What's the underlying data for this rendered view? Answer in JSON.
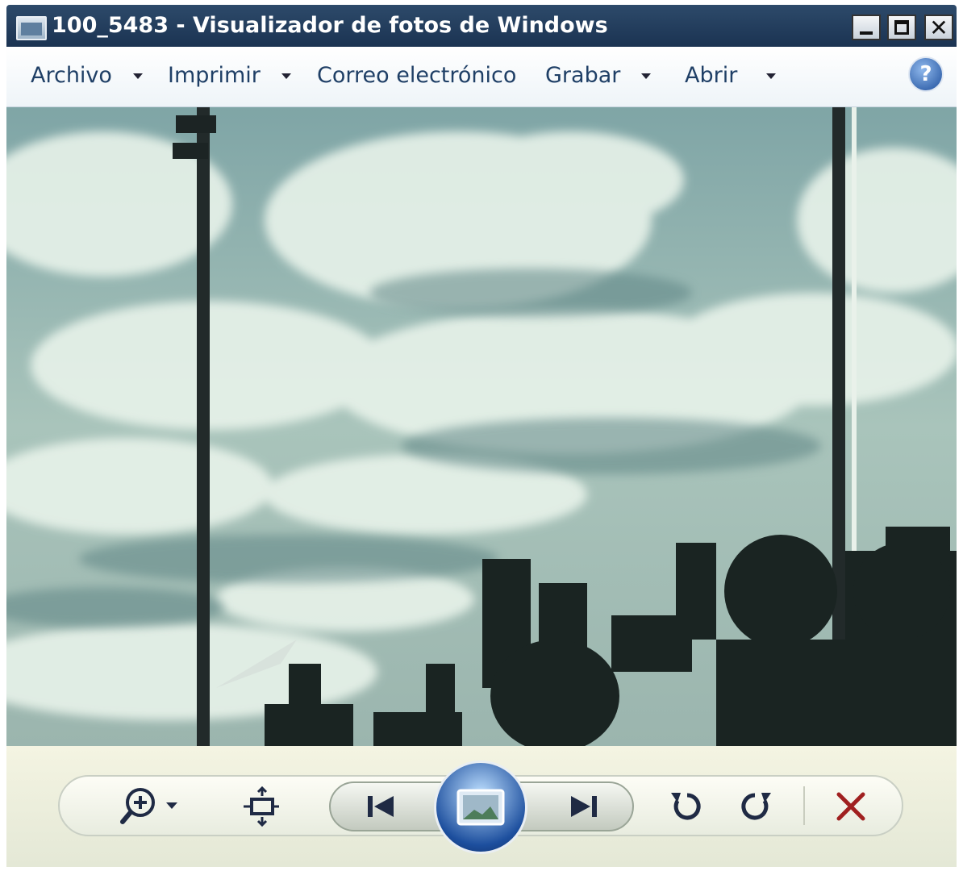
{
  "window": {
    "title": "100_5483 - Visualizador de fotos de Windows",
    "app_icon": "photo-viewer-icon",
    "controls": {
      "minimize": "minimize-icon",
      "maximize": "maximize-icon",
      "close": "✕"
    }
  },
  "menu": {
    "items": [
      {
        "label": "Archivo",
        "dropdown": true
      },
      {
        "label": "Imprimir",
        "dropdown": true
      },
      {
        "label": "Correo electrónico",
        "dropdown": false
      },
      {
        "label": "Grabar",
        "dropdown": true
      },
      {
        "label": "Abrir",
        "dropdown": true
      }
    ],
    "help": "?"
  },
  "photo": {
    "subject": "cloudy sky with light poles and crowd of photographers"
  },
  "controls": {
    "zoom": "zoom-in-icon",
    "fit": "actual-size-icon",
    "previous": "previous-icon",
    "slideshow": "slideshow-icon",
    "next": "next-icon",
    "rotate_left": "rotate-left-icon",
    "rotate_right": "rotate-right-icon",
    "delete": "delete-icon",
    "delete_color": "#a02020",
    "accent_color": "#1d4f9e"
  }
}
